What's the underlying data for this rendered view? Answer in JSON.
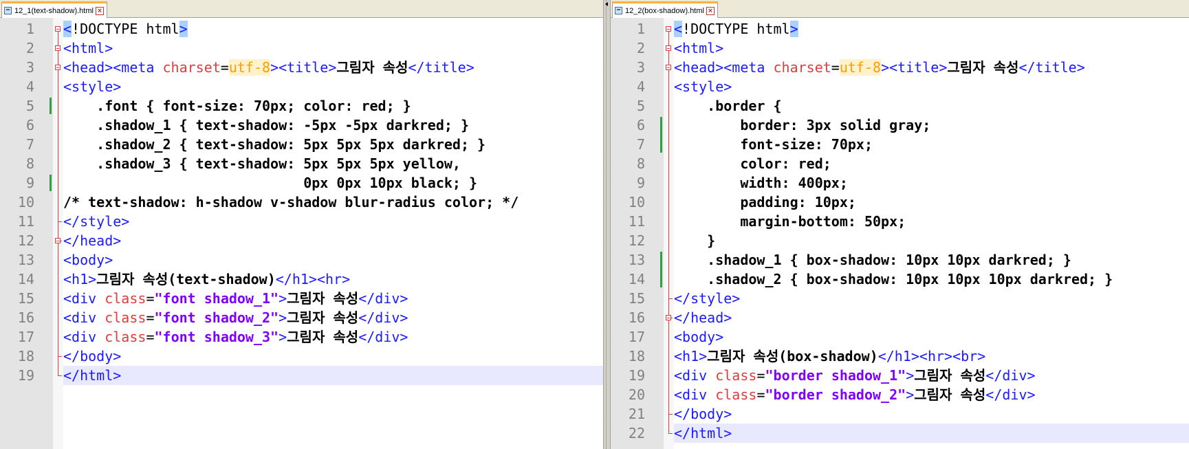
{
  "left": {
    "tab_title": "12_1(text-shadow).html",
    "lines": [
      [
        {
          "t": "<",
          "c": "tag hl"
        },
        {
          "t": "!DOCTYPE html",
          "c": "pl"
        },
        {
          "t": ">",
          "c": "tag hl"
        }
      ],
      [
        {
          "t": "<html>",
          "c": "tag"
        }
      ],
      [
        {
          "t": "<head><meta ",
          "c": "tag"
        },
        {
          "t": "charset",
          "c": "attr"
        },
        {
          "t": "=",
          "c": "pl"
        },
        {
          "t": "utf-8",
          "c": "val"
        },
        {
          "t": "><title>",
          "c": "tag"
        },
        {
          "t": "그림자 속성",
          "c": "pl bold"
        },
        {
          "t": "</title>",
          "c": "tag"
        }
      ],
      [
        {
          "t": "<style>",
          "c": "tag"
        }
      ],
      [
        {
          "t": "    .font { font-size: 70px; color: red; }",
          "c": "pl bold"
        }
      ],
      [
        {
          "t": "    .shadow_1 { text-shadow: -5px -5px darkred; }",
          "c": "pl bold"
        }
      ],
      [
        {
          "t": "    .shadow_2 { text-shadow: 5px 5px 5px darkred; }",
          "c": "pl bold"
        }
      ],
      [
        {
          "t": "    .shadow_3 { text-shadow: 5px 5px 5px yellow,",
          "c": "pl bold"
        }
      ],
      [
        {
          "t": "                             0px 0px 10px black; }",
          "c": "pl bold"
        }
      ],
      [
        {
          "t": "/* text-shadow: h-shadow v-shadow blur-radius color; */",
          "c": "pl bold"
        }
      ],
      [
        {
          "t": "</style>",
          "c": "tag"
        }
      ],
      [
        {
          "t": "</head>",
          "c": "tag"
        }
      ],
      [
        {
          "t": "<body>",
          "c": "tag"
        }
      ],
      [
        {
          "t": "<h1>",
          "c": "tag"
        },
        {
          "t": "그림자 속성(text-shadow)",
          "c": "pl bold"
        },
        {
          "t": "</h1><hr>",
          "c": "tag"
        }
      ],
      [
        {
          "t": "<div ",
          "c": "tag"
        },
        {
          "t": "class",
          "c": "attr"
        },
        {
          "t": "=",
          "c": "pl"
        },
        {
          "t": "\"font shadow_1\"",
          "c": "str"
        },
        {
          "t": ">",
          "c": "tag"
        },
        {
          "t": "그림자 속성",
          "c": "pl bold"
        },
        {
          "t": "</div>",
          "c": "tag"
        }
      ],
      [
        {
          "t": "<div ",
          "c": "tag"
        },
        {
          "t": "class",
          "c": "attr"
        },
        {
          "t": "=",
          "c": "pl"
        },
        {
          "t": "\"font shadow_2\"",
          "c": "str"
        },
        {
          "t": ">",
          "c": "tag"
        },
        {
          "t": "그림자 속성",
          "c": "pl bold"
        },
        {
          "t": "</div>",
          "c": "tag"
        }
      ],
      [
        {
          "t": "<div ",
          "c": "tag"
        },
        {
          "t": "class",
          "c": "attr"
        },
        {
          "t": "=",
          "c": "pl"
        },
        {
          "t": "\"font shadow_3\"",
          "c": "str"
        },
        {
          "t": ">",
          "c": "tag"
        },
        {
          "t": "그림자 속성",
          "c": "pl bold"
        },
        {
          "t": "</div>",
          "c": "tag"
        }
      ],
      [
        {
          "t": "</body>",
          "c": "tag"
        }
      ],
      [
        {
          "t": "</html>",
          "c": "tag"
        }
      ]
    ]
  },
  "right": {
    "tab_title": "12_2(box-shadow).html",
    "lines": [
      [
        {
          "t": "<",
          "c": "tag hl"
        },
        {
          "t": "!DOCTYPE html",
          "c": "pl"
        },
        {
          "t": ">",
          "c": "tag hl"
        }
      ],
      [
        {
          "t": "<html>",
          "c": "tag"
        }
      ],
      [
        {
          "t": "<head><meta ",
          "c": "tag"
        },
        {
          "t": "charset",
          "c": "attr"
        },
        {
          "t": "=",
          "c": "pl"
        },
        {
          "t": "utf-8",
          "c": "val"
        },
        {
          "t": "><title>",
          "c": "tag"
        },
        {
          "t": "그림자 속성",
          "c": "pl bold"
        },
        {
          "t": "</title>",
          "c": "tag"
        }
      ],
      [
        {
          "t": "<style>",
          "c": "tag"
        }
      ],
      [
        {
          "t": "    .border {",
          "c": "pl bold"
        }
      ],
      [
        {
          "t": "        border: 3px solid gray;",
          "c": "pl bold"
        }
      ],
      [
        {
          "t": "        font-size: 70px;",
          "c": "pl bold"
        }
      ],
      [
        {
          "t": "        color: red;",
          "c": "pl bold"
        }
      ],
      [
        {
          "t": "        width: 400px;",
          "c": "pl bold"
        }
      ],
      [
        {
          "t": "        padding: 10px;",
          "c": "pl bold"
        }
      ],
      [
        {
          "t": "        margin-bottom: 50px;",
          "c": "pl bold"
        }
      ],
      [
        {
          "t": "    }",
          "c": "pl bold"
        }
      ],
      [
        {
          "t": "    .shadow_1 { box-shadow: 10px 10px darkred; }",
          "c": "pl bold"
        }
      ],
      [
        {
          "t": "    .shadow_2 { box-shadow: 10px 10px 10px darkred; }",
          "c": "pl bold"
        }
      ],
      [
        {
          "t": "</style>",
          "c": "tag"
        }
      ],
      [
        {
          "t": "</head>",
          "c": "tag"
        }
      ],
      [
        {
          "t": "<body>",
          "c": "tag"
        }
      ],
      [
        {
          "t": "<h1>",
          "c": "tag"
        },
        {
          "t": "그림자 속성(box-shadow)",
          "c": "pl bold"
        },
        {
          "t": "</h1><hr><br>",
          "c": "tag"
        }
      ],
      [
        {
          "t": "<div ",
          "c": "tag"
        },
        {
          "t": "class",
          "c": "attr"
        },
        {
          "t": "=",
          "c": "pl"
        },
        {
          "t": "\"border shadow_1\"",
          "c": "str"
        },
        {
          "t": ">",
          "c": "tag"
        },
        {
          "t": "그림자 속성",
          "c": "pl bold"
        },
        {
          "t": "</div>",
          "c": "tag"
        }
      ],
      [
        {
          "t": "<div ",
          "c": "tag"
        },
        {
          "t": "class",
          "c": "attr"
        },
        {
          "t": "=",
          "c": "pl"
        },
        {
          "t": "\"border shadow_2\"",
          "c": "str"
        },
        {
          "t": ">",
          "c": "tag"
        },
        {
          "t": "그림자 속성",
          "c": "pl bold"
        },
        {
          "t": "</div>",
          "c": "tag"
        }
      ],
      [
        {
          "t": "</body>",
          "c": "tag"
        }
      ],
      [
        {
          "t": "</html>",
          "c": "tag"
        }
      ]
    ]
  }
}
